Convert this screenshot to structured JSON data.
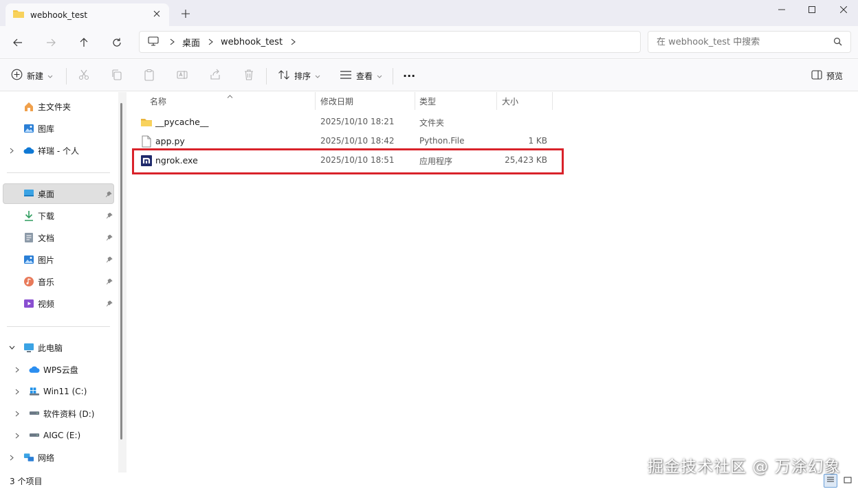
{
  "window": {
    "tab_title": "webhook_test",
    "new_tab": "+"
  },
  "nav": {
    "breadcrumb": [
      "桌面",
      "webhook_test"
    ],
    "search_placeholder": "在 webhook_test 中搜索"
  },
  "toolbar": {
    "new_label": "新建",
    "sort_label": "排序",
    "view_label": "查看",
    "more_label": "···",
    "preview_label": "预览"
  },
  "sidebar": {
    "quick": [
      {
        "label": "主文件夹",
        "icon": "home-icon"
      },
      {
        "label": "图库",
        "icon": "gallery-icon"
      },
      {
        "label": "祥瑞 - 个人",
        "icon": "onedrive-icon"
      }
    ],
    "pinned": [
      {
        "label": "桌面",
        "icon": "desktop-icon"
      },
      {
        "label": "下载",
        "icon": "download-icon"
      },
      {
        "label": "文档",
        "icon": "document-icon"
      },
      {
        "label": "图片",
        "icon": "pictures-icon"
      },
      {
        "label": "音乐",
        "icon": "music-icon"
      },
      {
        "label": "视频",
        "icon": "video-icon"
      }
    ],
    "this_pc_label": "此电脑",
    "drives": [
      {
        "label": "WPS云盘",
        "icon": "cloud-icon"
      },
      {
        "label": "Win11 (C:)",
        "icon": "windows-drive-icon"
      },
      {
        "label": "软件资料 (D:)",
        "icon": "drive-icon"
      },
      {
        "label": "AIGC (E:)",
        "icon": "drive-icon"
      }
    ],
    "network_label": "网络"
  },
  "columns": {
    "name": "名称",
    "date": "修改日期",
    "type": "类型",
    "size": "大小"
  },
  "files": [
    {
      "name": "__pycache__",
      "date": "2025/10/10 18:21",
      "type": "文件夹",
      "size": "",
      "icon": "folder-icon"
    },
    {
      "name": "app.py",
      "date": "2025/10/10 18:42",
      "type": "Python.File",
      "size": "1 KB",
      "icon": "file-icon"
    },
    {
      "name": "ngrok.exe",
      "date": "2025/10/10 18:51",
      "type": "应用程序",
      "size": "25,423 KB",
      "icon": "ngrok-icon"
    }
  ],
  "status": {
    "item_count": "3 个项目"
  },
  "watermark": "掘金技术社区 @ 万涂幻象",
  "colors": {
    "accent": "#0067c0",
    "highlight_border": "#d9222a",
    "folder": "#f4c542"
  }
}
